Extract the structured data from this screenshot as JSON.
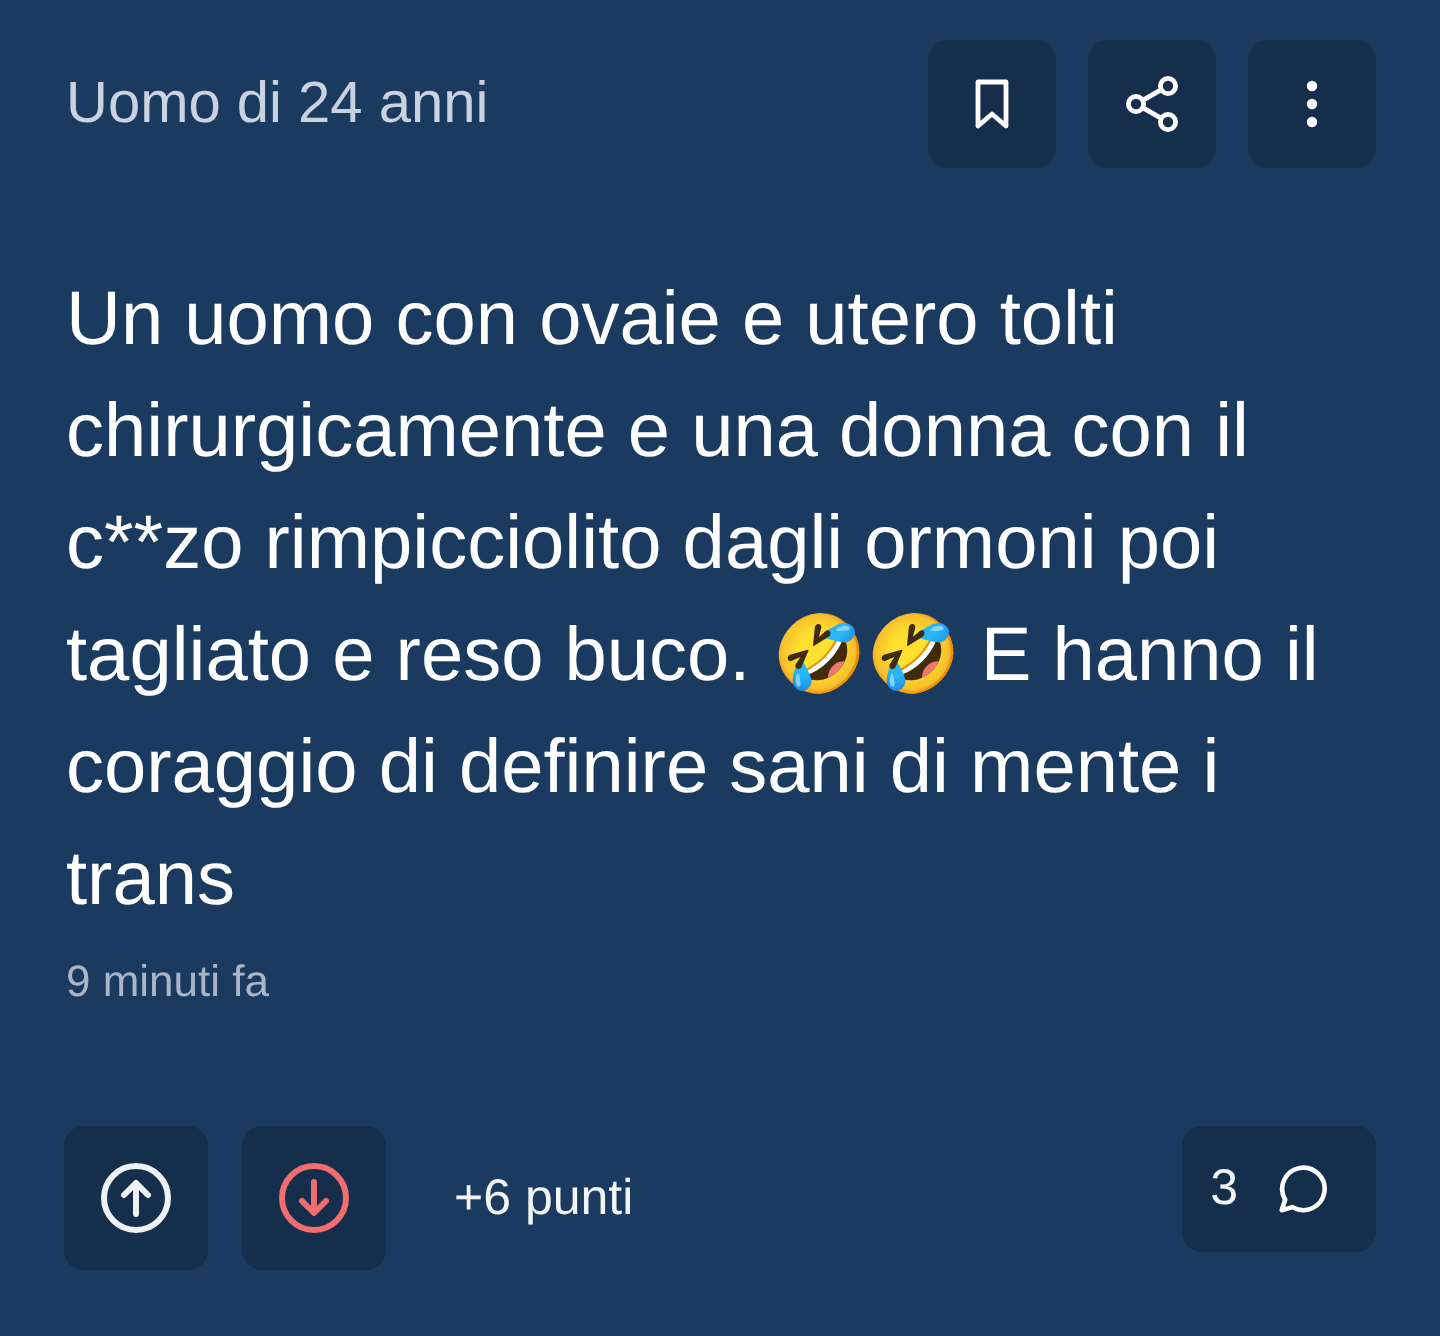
{
  "author": "Uomo di 24 anni",
  "body": "Un uomo con ovaie e utero tolti chirurgicamente e una donna con il c**zo rimpicciolito dagli ormoni poi tagliato e reso buco. 🤣🤣 E hanno il coraggio di definire sani di mente i trans",
  "time": "9 minuti fa",
  "score": "+6 punti",
  "comments": {
    "count": "3"
  }
}
